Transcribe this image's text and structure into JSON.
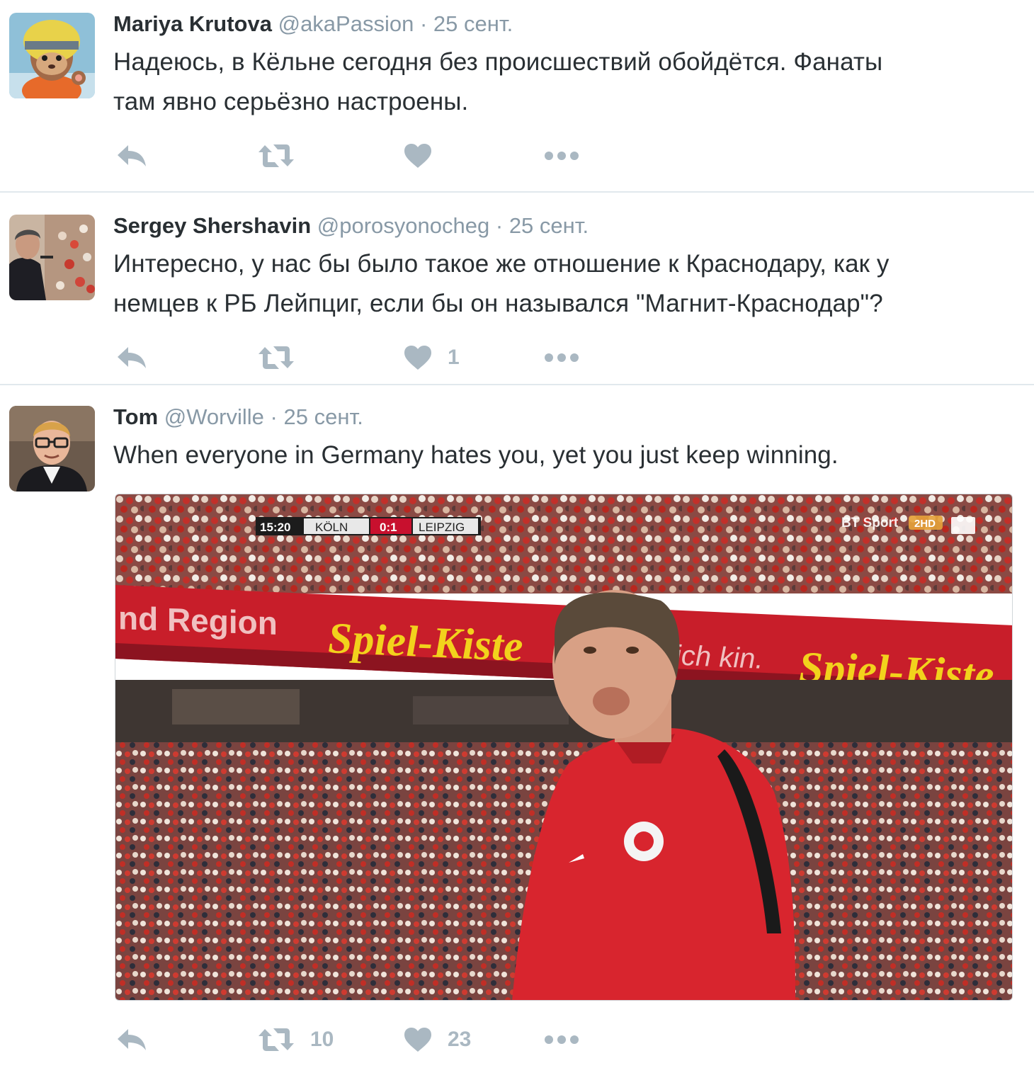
{
  "timeline": {
    "tweets": [
      {
        "name": "Mariya Krutova",
        "handle": "@akaPassion",
        "separator": "·",
        "time": "25 сент.",
        "text_lines": [
          "Надеюсь, в Кёльне сегодня без происшествий обойдётся. Фанаты",
          "там явно серьёзно настроены."
        ],
        "avatar_icon": "astronaut-bunny-avatar",
        "retweets": "",
        "likes": ""
      },
      {
        "name": "Sergey Shershavin",
        "handle": "@porosyonocheg",
        "separator": "·",
        "time": "25 сент.",
        "text_lines": [
          "Интересно, у нас бы было такое же отношение к Краснодару, как у",
          "немцев к РБ Лейпциг, если бы он назывался \"Магнит-Краснодар\"?"
        ],
        "avatar_icon": "speaker-at-podium-avatar",
        "retweets": "",
        "likes": "1"
      },
      {
        "name": "Tom",
        "handle": "@Worville",
        "separator": "·",
        "time": "25 сент.",
        "text_lines": [
          "When everyone in Germany hates you, yet you just keep winning."
        ],
        "avatar_icon": "man-with-glasses-avatar",
        "retweets": "10",
        "likes": "23",
        "media": {
          "scoreboard": {
            "clock": "15:20",
            "home": "KÖLN",
            "score": "0:1",
            "away": "LEIPZIG"
          },
          "broadcaster": "BT Sport",
          "channel": "2HD",
          "banner_left": "nd Region",
          "banner_ad": "Spiel-Kiste",
          "banner_mid": "ich kin."
        }
      }
    ]
  },
  "colors": {
    "icon_gray": "#aab8c2",
    "meta_gray": "#8899a6",
    "text": "#292f33",
    "divider": "#e1e8ed"
  }
}
